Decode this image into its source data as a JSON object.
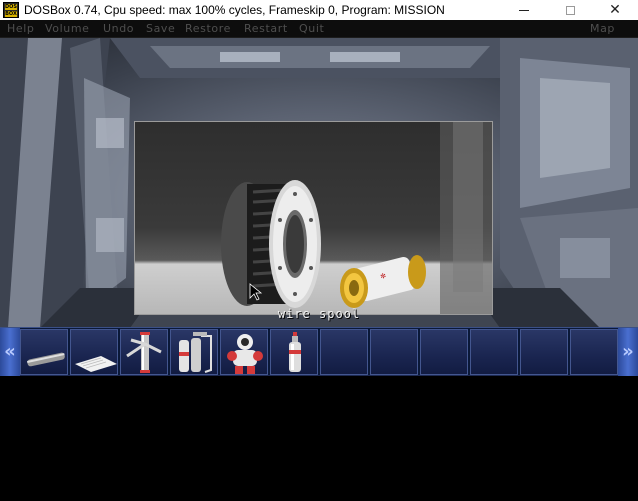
{
  "window": {
    "title": "DOSBox 0.74, Cpu speed: max 100% cycles, Frameskip  0, Program:  MISSION",
    "icon_top": "DOS",
    "icon_bottom": "BOX"
  },
  "menu": {
    "items": [
      "Help",
      "Volume",
      "Undo",
      "Save",
      "Restore",
      "Restart",
      "Quit"
    ],
    "map_label": "Map"
  },
  "scene": {
    "caption": "wire spool"
  },
  "inventory": {
    "items": [
      {
        "name": "pipe-icon"
      },
      {
        "name": "paper-sheet-icon"
      },
      {
        "name": "metal-tripod-icon"
      },
      {
        "name": "gas-welder-icon"
      },
      {
        "name": "robot-icon"
      },
      {
        "name": "spray-can-icon"
      },
      {
        "name": "empty"
      },
      {
        "name": "empty"
      },
      {
        "name": "empty"
      },
      {
        "name": "empty"
      },
      {
        "name": "empty"
      },
      {
        "name": "empty"
      }
    ]
  }
}
